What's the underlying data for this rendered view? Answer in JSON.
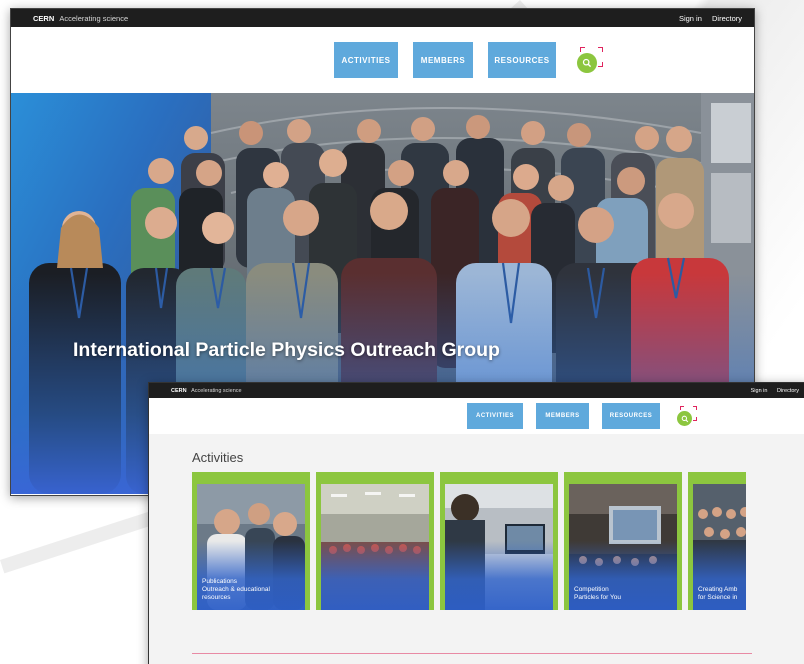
{
  "back_window": {
    "topbar": {
      "brand": "CERN",
      "tagline": "Accelerating science",
      "sign_in": "Sign in",
      "directory": "Directory"
    },
    "nav": {
      "activities": "ACTIVITIES",
      "members": "MEMBERS",
      "resources": "RESOURCES",
      "search_icon": "search-icon"
    },
    "hero": {
      "title": "International Particle Physics Outreach Group"
    }
  },
  "front_window": {
    "topbar": {
      "brand": "CERN",
      "tagline": "Accelerating science",
      "sign_in": "Sign in",
      "directory": "Directory"
    },
    "nav": {
      "activities": "ACTIVITIES",
      "members": "MEMBERS",
      "resources": "RESOURCES",
      "search_icon": "search-icon"
    },
    "section_title": "Activities",
    "cards": [
      {
        "label": "Publications\nOutreach & educational\nresources"
      },
      {
        "label": ""
      },
      {
        "label": ""
      },
      {
        "label": "Competition\nParticles for You"
      },
      {
        "label": "Creating Amb\nfor Science in"
      }
    ]
  },
  "colors": {
    "topbar": "#1e1e1e",
    "nav_button": "#5fa9dc",
    "accent_green": "#8cc63f",
    "focus_pink": "#e0245e",
    "hero_blue": "#2f6fd0",
    "rule_pink": "#e88aa4"
  }
}
